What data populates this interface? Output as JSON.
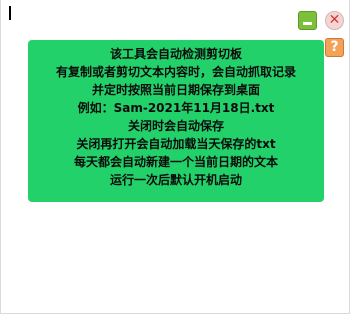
{
  "buttons": {
    "minimize_icon": "minimize-icon",
    "close_glyph": "✕",
    "help_glyph": "?"
  },
  "notice": {
    "lines": [
      "该工具会自动检测剪切板",
      "有复制或者剪切文本内容时，会自动抓取记录",
      "并定时按照当前日期保存到桌面",
      "例如：Sam-2021年11月18日.txt",
      "关闭时会自动保存",
      "关闭再打开会自动加载当天保存的txt",
      "每天都会自动新建一个当前日期的文本",
      "运行一次后默认开机启动"
    ]
  },
  "colors": {
    "notice_bg": "#23d16a",
    "minimize": "#7cbf3a",
    "close": "#d33b3b",
    "help": "#f3a25a"
  }
}
